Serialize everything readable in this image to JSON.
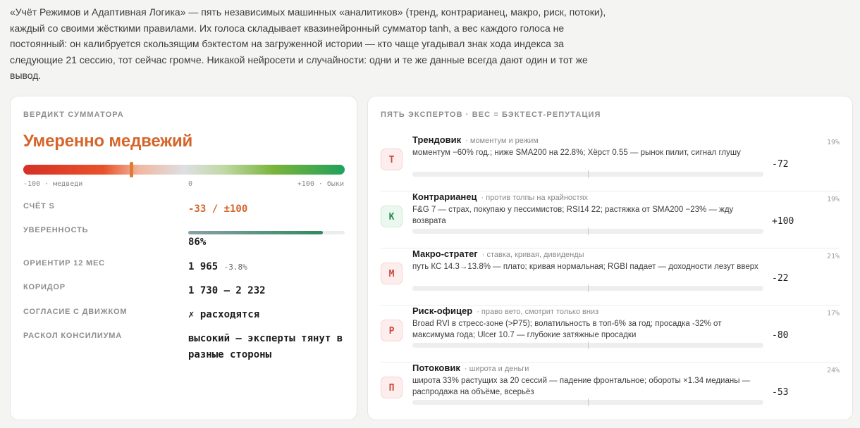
{
  "intro": "«Учёт Режимов и Адаптивная Логика» — пять независимых машинных «аналитиков» (тренд, контрарианец, макро, риск, потоки), каждый со своими жёсткими правилами. Их голоса складывает квазинейронный сумматор tanh, а вес каждого голоса не постоянный: он калибруется скользящим бэктестом на загруженной истории — кто чаще угадывал знак хода индекса за следующие 21 сессию, тот сейчас громче. Никакой нейросети и случайности: одни и те же данные всегда дают один и тот же вывод.",
  "verdict_panel": {
    "kicker": "ВЕРДИКТ СУММАТОРА",
    "verdict": "Умеренно медвежий",
    "gauge": {
      "min_label": "-100 · медведи",
      "mid_label": "0",
      "max_label": "+100 · быки",
      "score": -33
    },
    "rows": {
      "score_label": "СЧЁТ S",
      "score_value": "-33 / ±100",
      "confidence_label": "УВЕРЕННОСТЬ",
      "confidence_value": "86%",
      "confidence_fraction": 0.86,
      "target_label": "ОРИЕНТИР 12 МЕС",
      "target_value": "1 965",
      "target_delta": "-3.8%",
      "corridor_label": "КОРИДОР",
      "corridor_value": "1 730 – 2 232",
      "agreement_label": "СОГЛАСИЕ С ДВИЖКОМ",
      "agreement_value": "✗ расходятся",
      "split_label": "РАСКОЛ КОНСИЛИУМА",
      "split_value": "высокий — эксперты тянут в разные стороны"
    },
    "colors": {
      "verdict": "#d5652a",
      "marker": "#e07a34"
    }
  },
  "experts_panel": {
    "kicker": "ПЯТЬ ЭКСПЕРТОВ · ВЕС = БЭКТЕСТ-РЕПУТАЦИЯ",
    "experts": [
      {
        "badge": "Т",
        "name": "Трендовик",
        "tag": "· моментум и режим",
        "desc": "моментум −60% год.; ниже SMA200 на 22.8%; Хёрст 0.55 — рынок пилит, сигнал глушу",
        "score": "-72",
        "weight": "19%"
      },
      {
        "badge": "К",
        "name": "Контрарианец",
        "tag": "· против толпы на крайностях",
        "desc": "F&G 7 — страх, покупаю у пессимистов; RSI14 22; растяжка от SMA200 −23% — жду возврата",
        "score": "+100",
        "weight": "19%"
      },
      {
        "badge": "М",
        "name": "Макро-стратег",
        "tag": "· ставка, кривая, дивиденды",
        "desc": "путь КС 14.3→13.8% — плато; кривая нормальная; RGBI падает — доходности лезут вверх",
        "score": "-22",
        "weight": "21%"
      },
      {
        "badge": "Р",
        "name": "Риск-офицер",
        "tag": "· право вето, смотрит только вниз",
        "desc": "Broad RVI в стресс-зоне (>P75); волатильность в топ-6% за год; просадка -32% от максимума года; Ulcer 10.7 — глубокие затяжные просадки",
        "score": "-80",
        "weight": "17%"
      },
      {
        "badge": "П",
        "name": "Потоковик",
        "tag": "· широта и деньги",
        "desc": "широта 33% растущих за 20 сессий — падение фронтальное; обороты ×1.34 медианы — распродажа на объёме, всерьёз",
        "score": "-53",
        "weight": "24%"
      }
    ]
  }
}
